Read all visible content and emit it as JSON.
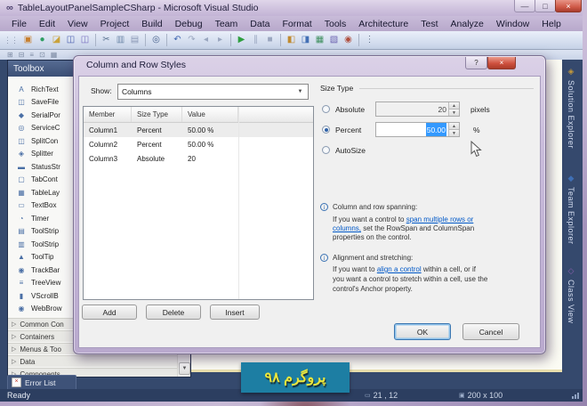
{
  "colors": {
    "selection": "#3399ff",
    "link": "#0058c8",
    "watermark_bg": "#1d7ea3",
    "watermark_text": "#e9e53c",
    "close_button": "#cf5a48",
    "status_bar_bg": "#2c3e60",
    "main_bg": "#35496d"
  },
  "window": {
    "title": "TableLayoutPanelSampleCSharp - Microsoft Visual Studio",
    "logo_glyph": "∞",
    "minimize_glyph": "—",
    "maximize_glyph": "□",
    "close_glyph": "×"
  },
  "menu": {
    "items": [
      "File",
      "Edit",
      "View",
      "Project",
      "Build",
      "Debug",
      "Team",
      "Data",
      "Format",
      "Tools",
      "Architecture",
      "Test",
      "Analyze",
      "Window",
      "Help"
    ]
  },
  "toolbar": {
    "handle": "⋮⋮",
    "icons": [
      {
        "name": "new-project",
        "glyph": "▣",
        "color": "#c77f2e"
      },
      {
        "name": "add-item",
        "glyph": "●",
        "color": "#2f9e63"
      },
      {
        "name": "open-file",
        "glyph": "◪",
        "color": "#c9a23c"
      },
      {
        "name": "save",
        "glyph": "◫",
        "color": "#4a5fae"
      },
      {
        "name": "save-all",
        "glyph": "◫",
        "color": "#7a6fc0"
      },
      {
        "name": "cut",
        "glyph": "✂",
        "color": "#5b7391"
      },
      {
        "name": "copy",
        "glyph": "▥",
        "color": "#6d87a8"
      },
      {
        "name": "paste",
        "glyph": "▤",
        "color": "#8a97b5"
      },
      {
        "name": "find",
        "glyph": "◎",
        "color": "#47608c"
      },
      {
        "name": "undo",
        "glyph": "↶",
        "color": "#3f65b0"
      },
      {
        "name": "redo",
        "glyph": "↷",
        "color": "#9aa6bf"
      },
      {
        "name": "navigate-back",
        "glyph": "◂",
        "color": "#9aa6bf"
      },
      {
        "name": "navigate-forward",
        "glyph": "▸",
        "color": "#9aa6bf"
      },
      {
        "name": "start-debug",
        "glyph": "▶",
        "color": "#2e9e3f"
      },
      {
        "name": "pause",
        "glyph": "∥",
        "color": "#9aa6bf"
      },
      {
        "name": "stop",
        "glyph": "■",
        "color": "#9aa6bf"
      },
      {
        "name": "solution-explorer",
        "glyph": "◧",
        "color": "#c08a30"
      },
      {
        "name": "properties-window",
        "glyph": "◨",
        "color": "#4470b5"
      },
      {
        "name": "toolbox-window",
        "glyph": "▦",
        "color": "#3f8f5f"
      },
      {
        "name": "extensions",
        "glyph": "▧",
        "color": "#6a5fae"
      },
      {
        "name": "error-list-window",
        "glyph": "◉",
        "color": "#b04f3f"
      },
      {
        "name": "overflow",
        "glyph": "⋮",
        "color": "#5b6b85"
      }
    ]
  },
  "mini_toolbar": {
    "icons": [
      {
        "name": "align-left",
        "glyph": "⊞"
      },
      {
        "name": "align-center",
        "glyph": "⊟"
      },
      {
        "name": "make-same-size",
        "glyph": "≡"
      },
      {
        "name": "snap-grid",
        "glyph": "⊡"
      },
      {
        "name": "layout-grid",
        "glyph": "▦"
      }
    ]
  },
  "toolbox": {
    "header": "Toolbox",
    "items": [
      {
        "glyph": "A",
        "label": "RichText"
      },
      {
        "glyph": "◫",
        "label": "SaveFile"
      },
      {
        "glyph": "◆",
        "label": "SerialPor"
      },
      {
        "glyph": "◎",
        "label": "ServiceC"
      },
      {
        "glyph": "◫",
        "label": "SplitCon"
      },
      {
        "glyph": "◈",
        "label": "Splitter"
      },
      {
        "glyph": "▬",
        "label": "StatusStr"
      },
      {
        "glyph": "▢",
        "label": "TabCont"
      },
      {
        "glyph": "▦",
        "label": "TableLay"
      },
      {
        "glyph": "▭",
        "label": "TextBox"
      },
      {
        "glyph": "◔",
        "label": "Timer"
      },
      {
        "glyph": "▤",
        "label": "ToolStrip"
      },
      {
        "glyph": "▥",
        "label": "ToolStrip"
      },
      {
        "glyph": "▲",
        "label": "ToolTip"
      },
      {
        "glyph": "◉",
        "label": "TrackBar"
      },
      {
        "glyph": "≡",
        "label": "TreeView"
      },
      {
        "glyph": "▮",
        "label": "VScrollB"
      },
      {
        "glyph": "◉",
        "label": "WebBrow"
      }
    ],
    "category_glyph": "▷",
    "categories": [
      "Common Con",
      "Containers",
      "Menus & Too",
      "Data",
      "Components"
    ],
    "scroll_down_glyph": "▼"
  },
  "right_tabs": {
    "items": [
      {
        "glyph": "◈",
        "label": "Solution Explorer"
      },
      {
        "glyph": "◆",
        "label": "Team Explorer"
      },
      {
        "glyph": "◇",
        "label": "Class View"
      }
    ]
  },
  "dialog": {
    "title": "Column and Row Styles",
    "help_glyph": "?",
    "close_glyph": "×",
    "show_label": "Show:",
    "show_value": "Columns",
    "dropdown_arrow": "▼",
    "grid": {
      "headers": [
        "Member",
        "Size Type",
        "Value"
      ],
      "rows": [
        {
          "member": "Column1",
          "size_type": "Percent",
          "value": "50.00 %"
        },
        {
          "member": "Column2",
          "size_type": "Percent",
          "value": "50.00 %"
        },
        {
          "member": "Column3",
          "size_type": "Absolute",
          "value": "20"
        }
      ]
    },
    "buttons": {
      "add": "Add",
      "delete": "Delete",
      "insert": "Insert",
      "ok": "OK",
      "cancel": "Cancel"
    },
    "size_type": {
      "label": "Size Type",
      "absolute_label": "Absolute",
      "absolute_value": "20",
      "absolute_unit": "pixels",
      "percent_label": "Percent",
      "percent_value": "50.00",
      "percent_unit": "%",
      "autosize_label": "AutoSize",
      "spin_up": "▲",
      "spin_down": "▼"
    },
    "info_spanning": {
      "icon": "i",
      "heading": "Column and row spanning:",
      "l1_pre": "If you want a control to ",
      "l1_link": "span multiple rows or",
      "l2_link": "columns,",
      "l2_post": " set the RowSpan and ColumnSpan",
      "l3": "properties on the control."
    },
    "info_alignment": {
      "icon": "i",
      "heading": "Alignment and stretching:",
      "l1_pre": "If you want to ",
      "l1_link": "align a control",
      "l1_post": " within a cell, or if",
      "l2": "you want a control to stretch within a cell, use the",
      "l3": "control's Anchor property."
    }
  },
  "error_list": {
    "label": "Error List",
    "icon_glyph": "×"
  },
  "status_bar": {
    "ready": "Ready",
    "position_icon": "▭",
    "position": "21 , 12",
    "size_icon": "▣",
    "size": "200 x 100"
  },
  "watermark": {
    "text": "پروگرم ۹۸"
  }
}
